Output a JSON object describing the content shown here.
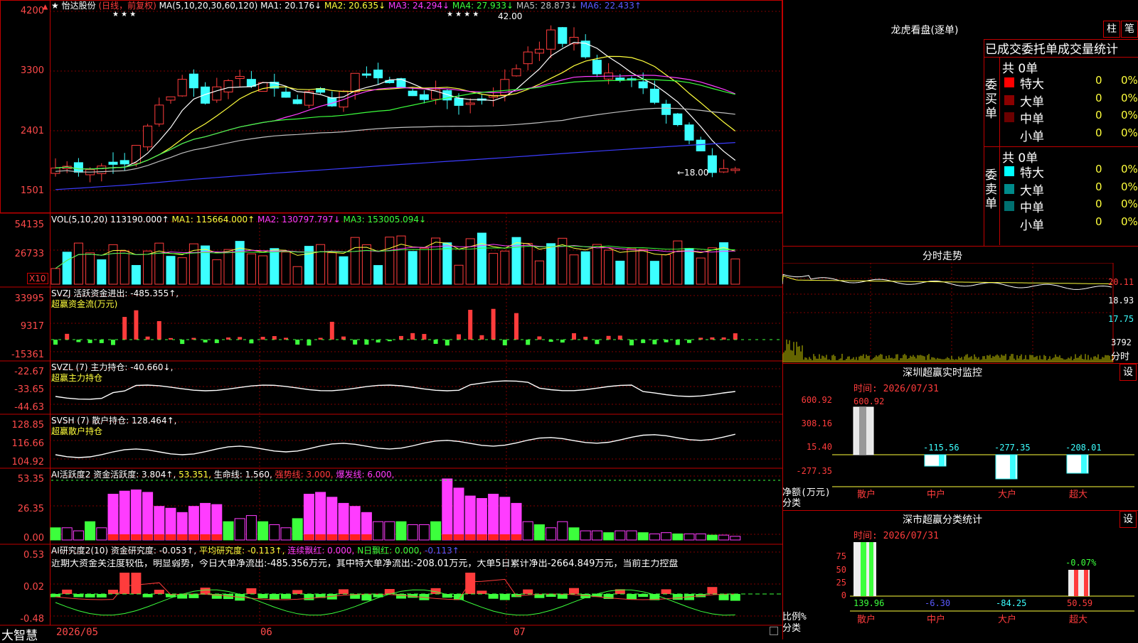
{
  "main": {
    "star": "★",
    "name": "怡达股份",
    "period": "(日线，前复权)",
    "ma_label": "MA(5,10,20,30,60,120)",
    "ma1": "MA1: 20.176↓",
    "ma2": "MA2: 20.635↓",
    "ma3": "MA3: 24.294↓",
    "ma4": "MA4: 27.933↓",
    "ma5": "MA5: 28.873↓",
    "ma6": "MA6: 22.433↑",
    "y_ticks": [
      "4200",
      "3300",
      "2401",
      "1501"
    ],
    "high_label": "42.00",
    "low_label": "←18.00",
    "stars_left": "★ ★ ★",
    "stars_right": "★ ★ ★ ★"
  },
  "vol": {
    "label": "VOL(5,10,20)",
    "val": "113190.000↑",
    "ma1": "MA1: 115664.000↑",
    "ma2": "MA2: 130797.797↓",
    "ma3": "MA3: 153005.094↓",
    "y_ticks": [
      "54135",
      "26733"
    ],
    "unit": "X10"
  },
  "svzj": {
    "label": "SVZJ  活跃资金进出: -485.355↑,",
    "sub": "超赢资金流(万元)",
    "y_ticks": [
      "33995",
      "9317",
      "-15361"
    ]
  },
  "svzl": {
    "label": "SVZL (7) 主力持仓: -40.660↓,",
    "sub": "超赢主力持仓",
    "y_ticks": [
      "-22.67",
      "-33.65",
      "-44.63"
    ]
  },
  "svsh": {
    "label": "SVSH (7) 散户持仓: 128.464↑,",
    "sub": "超赢散户持仓",
    "y_ticks": [
      "128.85",
      "116.66",
      "104.92"
    ]
  },
  "ai2": {
    "label": "AI活跃度2 资金活跃度: 3.804↑,",
    "v2": "53.351,",
    "v3": "生命线: 1.560,",
    "v4": "强势线: 3.000,",
    "v5": "爆发线: 6.000,",
    "y_ticks": [
      "53.35",
      "26.35",
      "0.00"
    ]
  },
  "ai_res": {
    "label": "AI研究度2(10) 资金研究度: -0.053↑,",
    "v2": "平均研究度: -0.113↑,",
    "v3": "连续飘红: 0.000,",
    "v4": "N日飘红: 0.000,",
    "v5": "-0.113↑",
    "text": "近期大资金关注度较低，明显弱势，今日大单净流出:-485.356万元，其中特大单净流出:-208.01万元，大单5日累计净出-2664.849万元，当前主力控盘",
    "y_ticks": [
      "0.53",
      "0.02",
      "-0.48"
    ]
  },
  "bottom": {
    "brand": "大智慧",
    "d1": "2026/05",
    "d2": "06",
    "d3": "07"
  },
  "dragon": {
    "title": "龙虎看盘(逐单)",
    "btn1": "柱",
    "btn2": "笔",
    "subtitle": "已成交委托单成交量统计",
    "buy_side": "委买单",
    "sell_side": "委卖单",
    "buy_total": "共 0单",
    "sell_total": "共 0单",
    "rows": [
      {
        "name": "特大",
        "v": "0",
        "p": "0%",
        "color": "#ff0000"
      },
      {
        "name": "大单",
        "v": "0",
        "p": "0%",
        "color": "#8b0000"
      },
      {
        "name": "中单",
        "v": "0",
        "p": "0%",
        "color": "#6b0000"
      },
      {
        "name": "小单",
        "v": "0",
        "p": "0%",
        "color": "#000000"
      }
    ],
    "sell_rows": [
      {
        "name": "特大",
        "v": "0",
        "p": "0%",
        "color": "#00ffff"
      },
      {
        "name": "大单",
        "v": "0",
        "p": "0%",
        "color": "#008b8b"
      },
      {
        "name": "中单",
        "v": "0",
        "p": "0%",
        "color": "#007070"
      },
      {
        "name": "小单",
        "v": "0",
        "p": "0%",
        "color": "#000000"
      }
    ]
  },
  "intraday": {
    "title": "分时走势",
    "p1": "20.11",
    "p2": "18.93",
    "p3": "17.75",
    "vol": "3792",
    "unit": "分时"
  },
  "sz_monitor": {
    "title": "深圳超赢实时监控",
    "btn": "设",
    "time": "时间: 2026/07/31",
    "y_ticks": [
      "600.92",
      "308.16",
      "15.40",
      "-277.35"
    ],
    "top_val": "600.92",
    "vals": [
      "-115.56",
      "-277.35",
      "-208.01"
    ],
    "axis_label1": "净额(万元)",
    "axis_label2": "分类",
    "cats": [
      "散户",
      "中户",
      "大户",
      "超大"
    ]
  },
  "sz_class": {
    "title": "深市超赢分类统计",
    "btn": "设",
    "time": "时间: 2026/07/31",
    "y_ticks": [
      "75",
      "50",
      "25",
      "0"
    ],
    "top_val": "-0.07%",
    "vals": [
      "139.96",
      "-6.30",
      "-84.25",
      "50.59"
    ],
    "axis_label1": "比例%",
    "axis_label2": "分类",
    "cats": [
      "散户",
      "中户",
      "大户",
      "超大"
    ]
  },
  "colors": {
    "up": "#ff3c3c",
    "down": "#3cffff",
    "grid": "#c00000"
  }
}
